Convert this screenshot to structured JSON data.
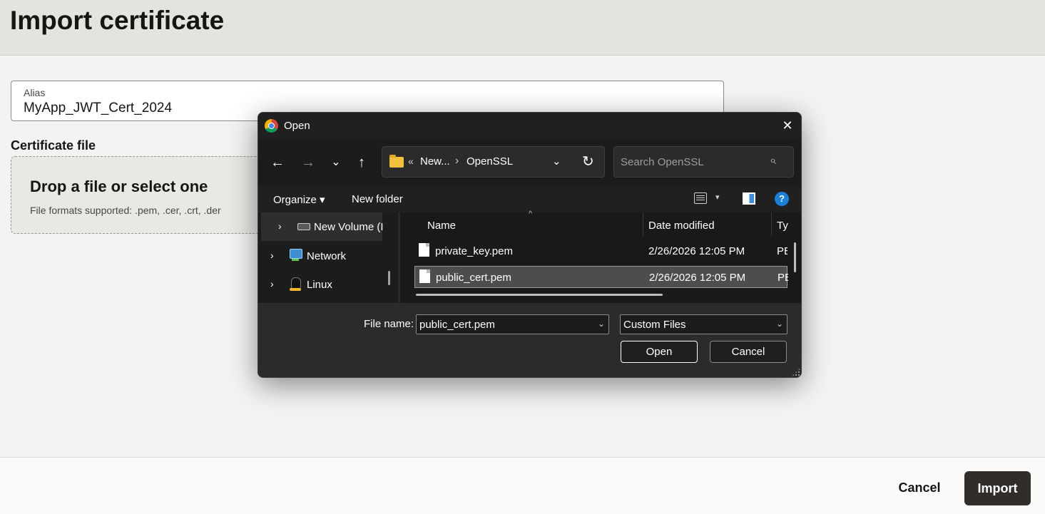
{
  "page": {
    "title": "Import certificate",
    "alias": {
      "label": "Alias",
      "value": "MyApp_JWT_Cert_2024"
    },
    "certificate_file": {
      "label": "Certificate file",
      "drop_title": "Drop a file or select one",
      "formats": "File formats supported: .pem, .cer, .crt, .der"
    },
    "footer": {
      "cancel": "Cancel",
      "import": "Import"
    }
  },
  "dialog": {
    "title": "Open",
    "close": "✕",
    "nav": {
      "back": "←",
      "forward": "→",
      "recent": "⌄",
      "up": "↑"
    },
    "address": {
      "overflow": "«",
      "crumb1": "New...",
      "sep": "›",
      "crumb2": "OpenSSL",
      "chevron": "⌄",
      "refresh": "↻"
    },
    "search": {
      "placeholder": "Search OpenSSL",
      "icon": "⌕"
    },
    "toolbar": {
      "organize": "Organize ▾",
      "new_folder": "New folder",
      "view_caret": "▾",
      "help": "?"
    },
    "tree": [
      {
        "label": "New Volume (I",
        "arrow": "›"
      },
      {
        "label": "Network",
        "arrow": "›"
      },
      {
        "label": "Linux",
        "arrow": "›"
      }
    ],
    "columns": {
      "name": "Name",
      "date": "Date modified",
      "type": "Ty",
      "sort": "^"
    },
    "files": [
      {
        "name": "private_key.pem",
        "date": "2/26/2026 12:05 PM",
        "type": "PE"
      },
      {
        "name": "public_cert.pem",
        "date": "2/26/2026 12:05 PM",
        "type": "PE"
      }
    ],
    "filename": {
      "label": "File name:",
      "value": "public_cert.pem",
      "chevron": "⌄"
    },
    "filetype": {
      "value": "Custom Files",
      "chevron": "⌄"
    },
    "buttons": {
      "open": "Open",
      "cancel": "Cancel"
    }
  }
}
